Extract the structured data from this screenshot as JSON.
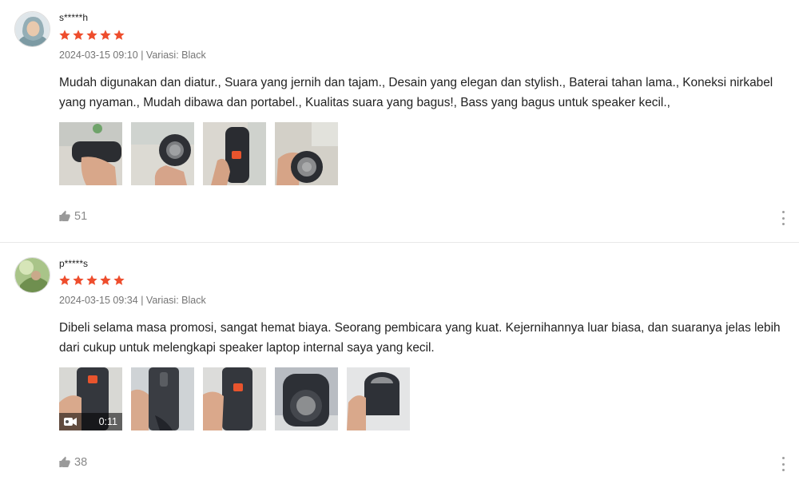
{
  "colors": {
    "star": "#ee4d2d",
    "meta": "#757575",
    "like": "#8a8a8a",
    "divider": "#e8e8e8"
  },
  "reviews": [
    {
      "username": "s*****h",
      "rating": 5,
      "date": "2024-03-15 09:10",
      "variation": "Variasi: Black",
      "comment": "Mudah digunakan dan diatur., Suara yang jernih dan tajam., Desain yang elegan dan stylish., Baterai tahan lama., Koneksi nirkabel yang nyaman., Mudah dibawa dan portabel., Kualitas suara yang bagus!, Bass yang bagus untuk speaker kecil.,",
      "likes": "51",
      "media_count": 4
    },
    {
      "username": "p*****s",
      "rating": 5,
      "date": "2024-03-15 09:34",
      "variation": "Variasi: Black",
      "comment": "Dibeli selama masa promosi, sangat hemat biaya. Seorang pembicara yang kuat. Kejernihannya luar biasa, dan suaranya jelas lebih dari cukup untuk melengkapi speaker laptop internal saya yang kecil.",
      "likes": "38",
      "media_count": 5,
      "video_duration": "0:11"
    }
  ]
}
